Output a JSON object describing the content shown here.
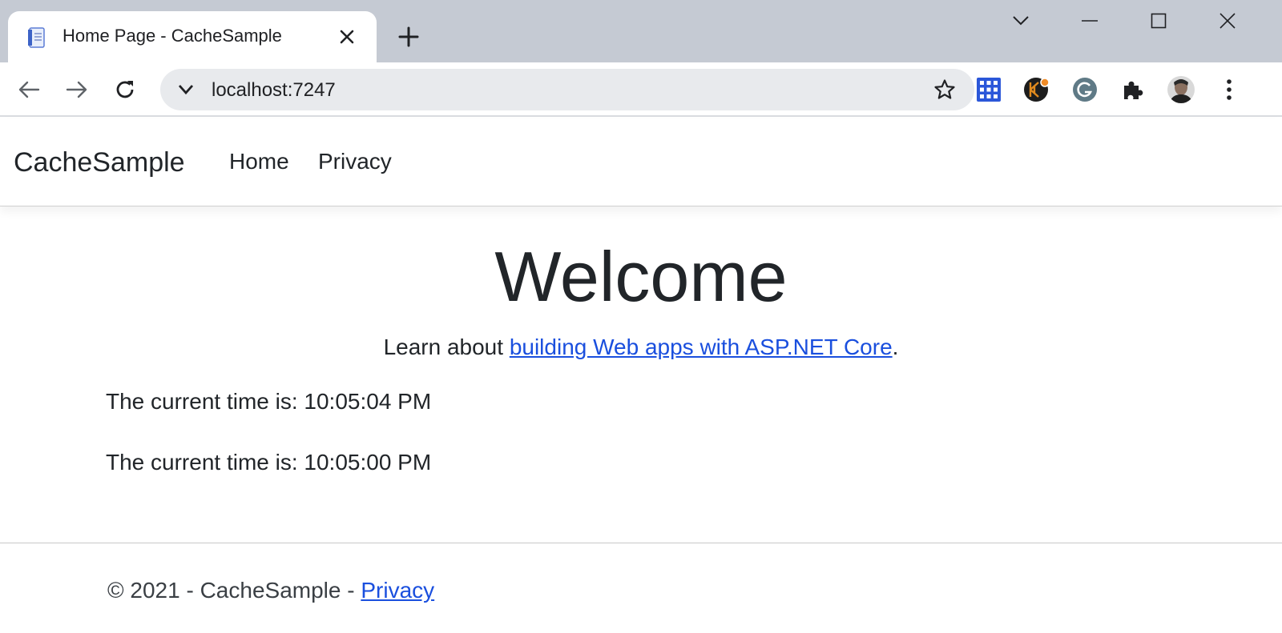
{
  "browser": {
    "tab": {
      "title": "Home Page - CacheSample",
      "favicon": "document-icon"
    },
    "address": {
      "url": "localhost:7247"
    },
    "colors": {
      "tabstrip": "#c5cad3",
      "omnibox": "#e8eaed"
    }
  },
  "site": {
    "brand": "CacheSample",
    "nav": [
      {
        "label": "Home"
      },
      {
        "label": "Privacy"
      }
    ]
  },
  "main": {
    "heading": "Welcome",
    "learn_prefix": "Learn about ",
    "learn_link": "building Web apps with ASP.NET Core",
    "learn_suffix": ".",
    "times": [
      "The current time is: 10:05:04 PM",
      "The current time is: 10:05:00 PM"
    ]
  },
  "footer": {
    "text": "© 2021 - CacheSample - ",
    "link": "Privacy"
  },
  "colors": {
    "link": "#1a4fde",
    "text": "#212529"
  }
}
